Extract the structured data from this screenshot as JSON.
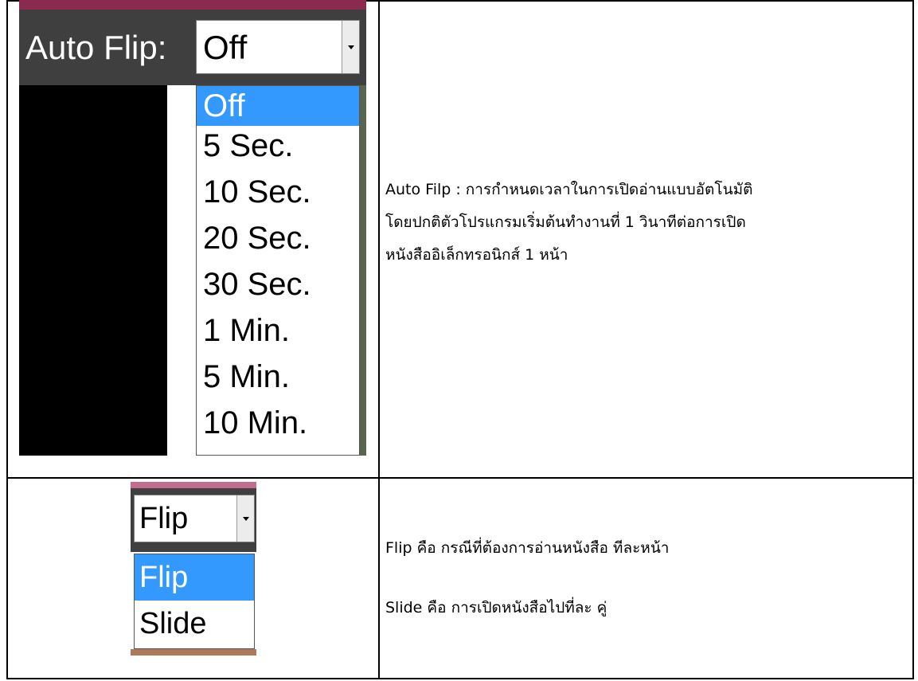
{
  "row1": {
    "label": "Auto Flip:",
    "selected": "Off",
    "options": [
      "Off",
      "5 Sec.",
      "10 Sec.",
      "20 Sec.",
      "30 Sec.",
      "1 Min.",
      "5 Min.",
      "10 Min."
    ],
    "selected_index": 0,
    "description_lines": [
      "Auto Filp : การกำหนดเวลาในการเปิดอ่านแบบอัตโนมัติ",
      "โดยปกติตัวโปรแกรมเริ่มต้นทำงานที่ 1 วินาทีต่อการเปิด",
      "หนังสืออิเล็กทรอนิกส์ 1 หน้า"
    ]
  },
  "row2": {
    "selected": "Flip",
    "options": [
      "Flip",
      "Slide"
    ],
    "selected_index": 0,
    "description_flip": "Flip  คือ กรณีที่ต้องการอ่านหนังสือ ทีละหน้า",
    "description_slide": "Slide คือ การเปิดหนังสือไปที่ละ คู่"
  },
  "colors": {
    "highlight": "#3399ff",
    "toolbar": "#3f3f3f",
    "top_accent": "#8a2a4e"
  },
  "icons": {
    "dropdown": "chevron-down-icon"
  }
}
